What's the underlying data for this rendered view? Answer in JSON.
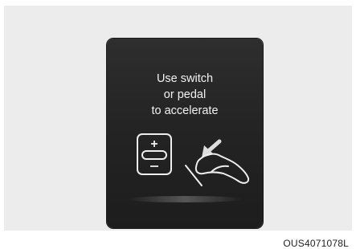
{
  "cluster": {
    "message_lines": [
      "Use switch",
      "or pedal",
      "to accelerate"
    ]
  },
  "icons": {
    "switch": "plus-minus-switch-icon",
    "pedal": "accelerator-pedal-icon",
    "arrow": "press-arrow-icon"
  },
  "figure_code": "OUS4071078L",
  "colors": {
    "display_bg": "#242424",
    "text": "#f2f2f2",
    "frame_bg": "#ececec"
  }
}
